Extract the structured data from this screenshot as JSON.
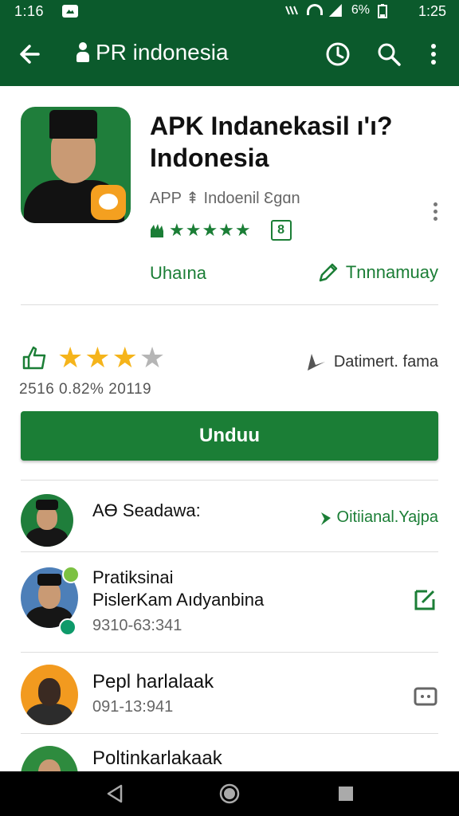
{
  "status_bar": {
    "time_left": "1:16",
    "battery": "6%",
    "time_right": "1:25"
  },
  "app_bar": {
    "title": "PR indonesia",
    "icons": [
      "back-arrow-icon",
      "person-icon",
      "history-icon",
      "search-icon",
      "more-vert-icon"
    ]
  },
  "app": {
    "title": "APK Indanekasil ı'ı? Indonesia",
    "developer": "APP ⇞ Indoenil Ɛgɑn",
    "stars_small": "★★★★★",
    "content_rating": "8",
    "category": "Uhaına",
    "wishlist_label": "Tnnnamuay"
  },
  "rating": {
    "stars_filled": 3,
    "stars_total": 4,
    "date_label": "Datimert. fama",
    "stats": "2516 0.82% 20119"
  },
  "install_button": "Unduu",
  "list": [
    {
      "title": "AƟ Seadawa:",
      "action": "Oitiianal.Yajpa"
    },
    {
      "title": "Pratiksinai",
      "subtitle": "PislerKam Aıdyanbina",
      "number": "9310-63:341"
    },
    {
      "title": "Pepl harlalaak",
      "number": "091-13:941"
    },
    {
      "title": "Poltinkarlakaak"
    }
  ],
  "colors": {
    "primary": "#0b5a2c",
    "accent": "#1b7e36",
    "star": "#f5b41b"
  }
}
